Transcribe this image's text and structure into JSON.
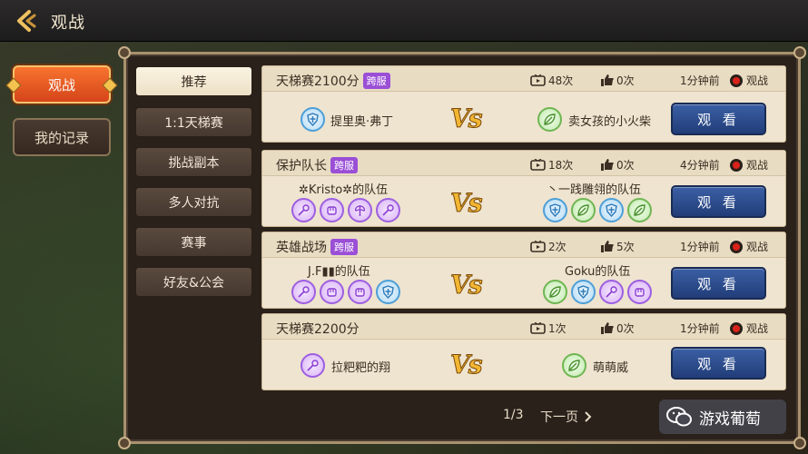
{
  "header": {
    "title": "观战"
  },
  "left_tabs": [
    {
      "label": "观战",
      "active": true
    },
    {
      "label": "我的记录",
      "active": false
    }
  ],
  "categories": [
    {
      "label": "推荐",
      "active": true
    },
    {
      "label": "1:1天梯赛",
      "active": false
    },
    {
      "label": "挑战副本",
      "active": false
    },
    {
      "label": "多人对抗",
      "active": false
    },
    {
      "label": "赛事",
      "active": false
    },
    {
      "label": "好友&公会",
      "active": false
    }
  ],
  "matches": [
    {
      "title": "天梯赛2100分",
      "cross_server": "跨服",
      "views": "48次",
      "likes": "0次",
      "time": "1分钟前",
      "watch_label": "观战",
      "left_team": "提里奥·弗丁",
      "right_team": "卖女孩的小火柴",
      "vs": "Vs",
      "button": "观 看"
    },
    {
      "title": "保护队长",
      "cross_server": "跨服",
      "views": "18次",
      "likes": "0次",
      "time": "4分钟前",
      "watch_label": "观战",
      "left_team": "✲Kristo✲的队伍",
      "right_team": "丶一践雕翎的队伍",
      "vs": "Vs",
      "button": "观 看"
    },
    {
      "title": "英雄战场",
      "cross_server": "跨服",
      "views": "2次",
      "likes": "5次",
      "time": "1分钟前",
      "watch_label": "观战",
      "left_team": "J.F▮▮的队伍",
      "right_team": "Goku的队伍",
      "vs": "Vs",
      "button": "观 看"
    },
    {
      "title": "天梯赛2200分",
      "cross_server": "",
      "views": "1次",
      "likes": "0次",
      "time": "1分钟前",
      "watch_label": "观战",
      "left_team": "拉粑粑的翔",
      "right_team": "萌萌威",
      "vs": "Vs",
      "button": "观 看"
    }
  ],
  "pager": {
    "page": "1/3",
    "next": "下一页"
  },
  "watermark": {
    "text": "游戏葡萄"
  },
  "colors": {
    "accent": "#f26a2a",
    "button_blue": "#2b4a8c",
    "card_bg": "#efe4cf",
    "vs_gold": "#f2b632"
  }
}
